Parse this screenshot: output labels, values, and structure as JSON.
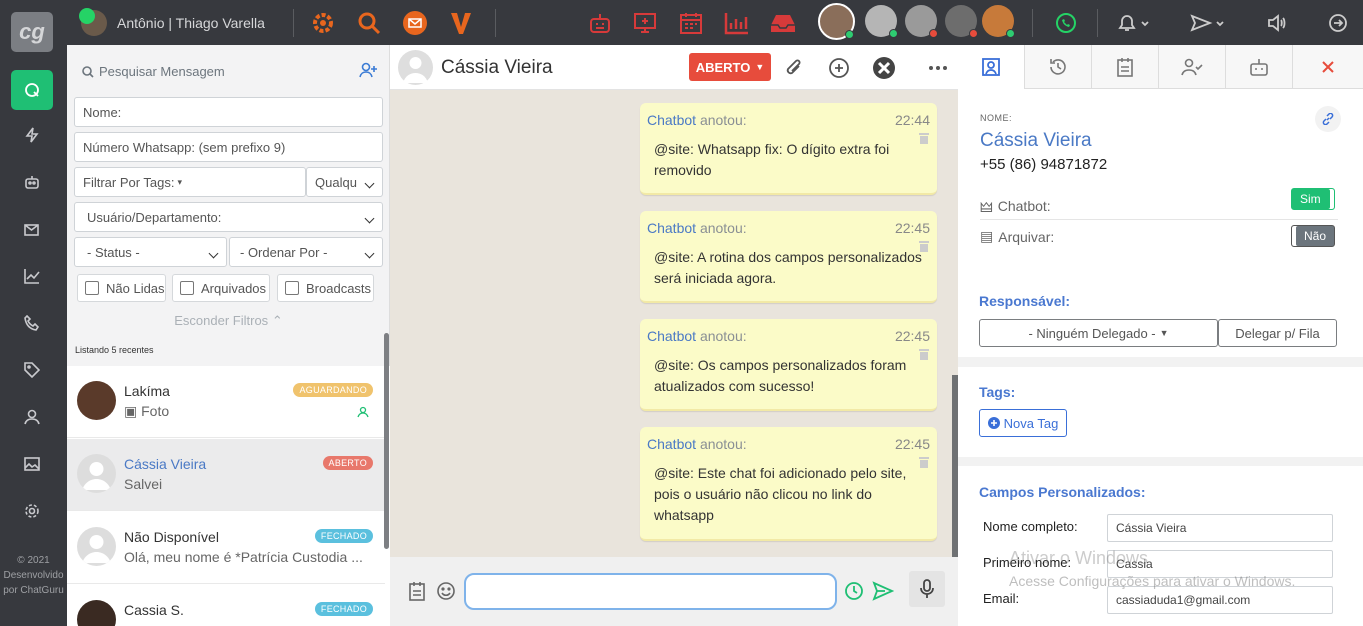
{
  "user": {
    "name": "Antônio | Thiago Varella"
  },
  "footer": {
    "line1": "© 2021",
    "line2": "Desenvolvido",
    "line3": "por ChatGuru"
  },
  "logo": "cg",
  "search": {
    "placeholder": "Pesquisar Mensagem"
  },
  "filters": {
    "name_placeholder": "Nome:",
    "phone_placeholder": "Número Whatsapp: (sem prefixo 9)",
    "tags_label": "Filtrar Por Tags:",
    "any_label": "Qualqu",
    "user_dept": "Usuário/Departamento:",
    "status": "- Status -",
    "order": "- Ordenar Por -",
    "unread": "Não Lidas",
    "archived": "Arquivados",
    "broadcasts": "Broadcasts",
    "hide": "Esconder Filtros"
  },
  "listing": "Listando 5 recentes",
  "chats": [
    {
      "name": "Lakíma",
      "message": "Foto",
      "status": "AGUARDANDO",
      "color": "#f0c36d"
    },
    {
      "name": "Cássia Vieira",
      "message": "Salvei",
      "status": "ABERTO",
      "color": "#e8786b"
    },
    {
      "name": "Não Disponível",
      "message": "Olá, meu nome é *Patrícia Custodia ...",
      "status": "FECHADO",
      "color": "#5bc0de"
    },
    {
      "name": "Cassia S.",
      "message": "",
      "status": "FECHADO",
      "color": "#5bc0de"
    }
  ],
  "conversation": {
    "name": "Cássia Vieira",
    "status_button": "ABERTO",
    "messages": [
      {
        "author": "Chatbot",
        "verb": "anotou:",
        "time": "22:44",
        "text": "@site: Whatsapp fix: O dígito extra foi removido"
      },
      {
        "author": "Chatbot",
        "verb": "anotou:",
        "time": "22:45",
        "text": "@site: A rotina dos campos personalizados será iniciada agora."
      },
      {
        "author": "Chatbot",
        "verb": "anotou:",
        "time": "22:45",
        "text": "@site: Os campos personalizados foram atualizados com sucesso!"
      },
      {
        "author": "Chatbot",
        "verb": "anotou:",
        "time": "22:45",
        "text": "@site: Este chat foi adicionado pelo site, pois o usuário não clicou no link do whatsapp"
      }
    ]
  },
  "contact": {
    "name_label": "NOME:",
    "name": "Cássia Vieira",
    "phone": "+55 (86) 94871872",
    "chatbot_label": "Chatbot:",
    "chatbot_value": "Sim",
    "archive_label": "Arquivar:",
    "archive_value": "Não",
    "responsible_title": "Responsável:",
    "nobody": "- Ninguém Delegado -",
    "delegate_queue": "Delegar p/ Fila",
    "tags_title": "Tags:",
    "new_tag": "Nova Tag",
    "custom_title": "Campos Personalizados:",
    "fields": [
      {
        "label": "Nome completo:",
        "value": "Cássia Vieira"
      },
      {
        "label": "Primeiro nome:",
        "value": "Cassia"
      },
      {
        "label": "Email:",
        "value": "cassiaduda1@gmail.com"
      }
    ]
  },
  "watermark": {
    "line1": "Ativar o Windows",
    "line2": "Acesse Configurações para ativar o Windows."
  },
  "colors": {
    "accent": "#1fbf74",
    "link": "#4a78d0",
    "danger": "#e74c3c",
    "bubble": "#fbfbc8"
  }
}
